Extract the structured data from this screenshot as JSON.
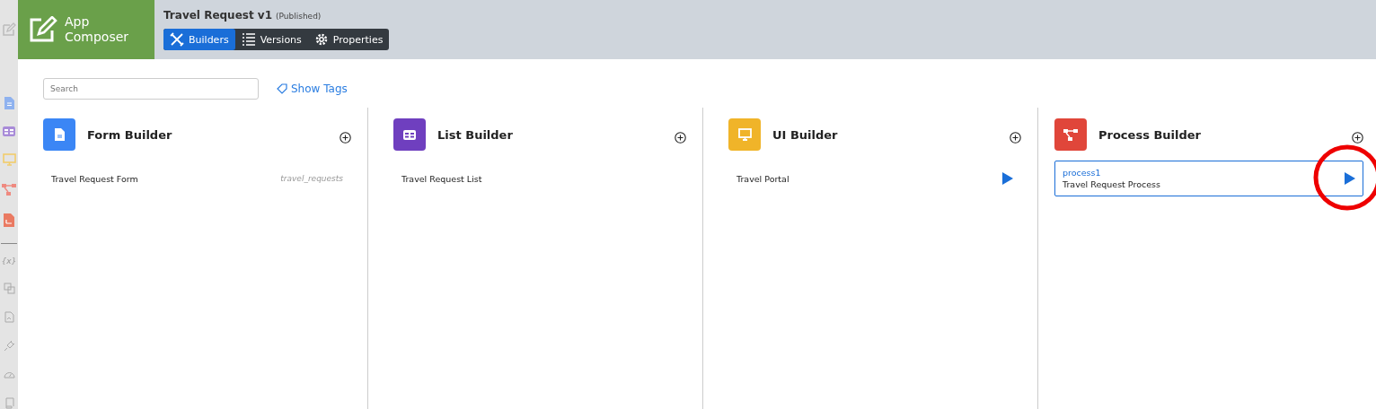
{
  "app": {
    "name_line1": "App",
    "name_line2": "Composer"
  },
  "title": "Travel Request v1",
  "status": "(Published)",
  "tabs": [
    {
      "label": "Builders",
      "selected": true
    },
    {
      "label": "Versions",
      "selected": false
    },
    {
      "label": "Properties",
      "selected": false
    }
  ],
  "sidebar": {
    "items": [
      {
        "kind": "form"
      },
      {
        "kind": "list"
      },
      {
        "kind": "ui"
      },
      {
        "kind": "process"
      },
      {
        "kind": "report"
      },
      {
        "kind": "divider"
      },
      {
        "kind": "text",
        "label": "{x}"
      },
      {
        "kind": "resources"
      },
      {
        "kind": "file"
      },
      {
        "kind": "plugin"
      },
      {
        "kind": "gauge"
      },
      {
        "kind": "scroll"
      }
    ]
  },
  "search": {
    "placeholder": "Search"
  },
  "show_tags": "Show Tags",
  "builders": [
    {
      "kind": "form",
      "title": "Form Builder",
      "items": [
        {
          "name": "Travel Request Form",
          "tag": "travel_requests",
          "run": false,
          "selected": false,
          "circled": false
        }
      ]
    },
    {
      "kind": "list",
      "title": "List Builder",
      "items": [
        {
          "name": "Travel Request List",
          "run": false,
          "selected": false,
          "circled": false
        }
      ]
    },
    {
      "kind": "ui",
      "title": "UI Builder",
      "items": [
        {
          "name": "Travel Portal",
          "run": true,
          "selected": false,
          "circled": false
        }
      ]
    },
    {
      "kind": "process",
      "title": "Process Builder",
      "items": [
        {
          "id": "process1",
          "name": "Travel Request Process",
          "run": true,
          "selected": true,
          "circled": true
        }
      ]
    }
  ]
}
